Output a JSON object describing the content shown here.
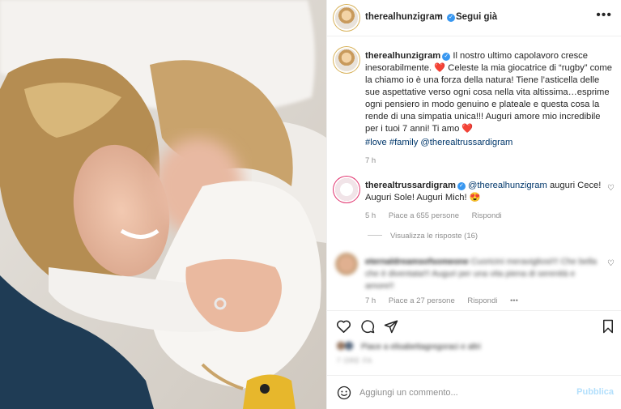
{
  "post": {
    "author": "therealhunzigram",
    "separator": "•",
    "follow_label": "Segui già",
    "more_label": "•••"
  },
  "caption": {
    "author": "therealhunzigram",
    "text": " Il nostro ultimo capolavoro cresce inesorabilmente. ❤️ Celeste la mia giocatrice di “rugby” come la chiamo io è una forza della natura! Tiene l’asticella delle sue aspettative verso ogni cosa nella vita altissima…esprime ogni pensiero in modo genuino e plateale e questa cosa la rende di una simpatia unica!!! Auguri amore mio incredibile per i tuoi 7 anni! Ti amo ❤️",
    "hashtags": "#love #family @therealtrussardigram",
    "time": "7 h"
  },
  "comments": [
    {
      "author": "therealtrussardigram",
      "mention": "@therealhunzigram",
      "text": " auguri Cece! Auguri Sole! Auguri Mich! 😍",
      "time": "5 h",
      "likes": "Piace a 655 persone",
      "reply": "Rispondi",
      "view_replies": "Visualizza le risposte (16)"
    },
    {
      "author": "eternaldreamsofsomeone",
      "text": "Cuoricini meravigliosi!!! Che bella che è diventata!!! Auguri per una vita piena di serenità e amore!!",
      "time": "7 h",
      "likes": "Piace a 27 persone",
      "reply": "Rispondi",
      "more": "•••"
    }
  ],
  "likes_summary": "Piace a elisabettagregoraci e altri",
  "date": "7 ORE FA",
  "composer": {
    "placeholder": "Aggiungi un commento...",
    "publish": "Pubblica"
  },
  "colors": {
    "link": "#00376b",
    "verified": "#3897f0",
    "publish_disabled": "#b2dffc",
    "heart": "#ed4956"
  },
  "icons": [
    "verified-badge-icon",
    "more-icon",
    "heart-icon",
    "comment-icon",
    "share-icon",
    "bookmark-icon",
    "emoji-icon"
  ]
}
